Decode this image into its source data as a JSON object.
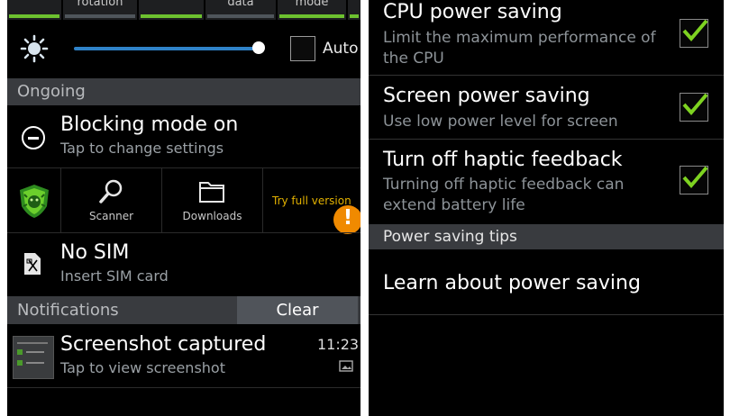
{
  "quick_settings": {
    "toggles": [
      {
        "label": "",
        "on": true
      },
      {
        "label": "rotation",
        "on": false
      },
      {
        "label": "",
        "on": true
      },
      {
        "label": "data",
        "on": false
      },
      {
        "label": "mode",
        "on": true
      }
    ]
  },
  "brightness": {
    "auto_label": "Auto",
    "auto_checked": false,
    "level": 0.97
  },
  "ongoing": {
    "header": "Ongoing",
    "blocking": {
      "title": "Blocking mode on",
      "subtitle": "Tap to change settings"
    },
    "widget": {
      "scanner": "Scanner",
      "downloads": "Downloads",
      "try_full": "Try full version",
      "alert": "!"
    },
    "sim": {
      "title": "No SIM",
      "subtitle": "Insert SIM card"
    }
  },
  "notifications": {
    "header": "Notifications",
    "clear_label": "Clear",
    "items": [
      {
        "title": "Screenshot captured",
        "subtitle": "Tap to view screenshot",
        "time": "11:23"
      }
    ]
  },
  "power_saving": {
    "items": [
      {
        "title": "CPU power saving",
        "subtitle_line1": "Limit the maximum performance of",
        "subtitle_line2": "the CPU",
        "checked": true
      },
      {
        "title": "Screen power saving",
        "subtitle_line1": "Use low power level for screen",
        "subtitle_line2": "",
        "checked": true
      },
      {
        "title": "Turn off haptic feedback",
        "subtitle_line1": "Turning off haptic feedback can",
        "subtitle_line2": "extend battery life",
        "checked": true
      }
    ],
    "tips_header": "Power saving tips",
    "learn_label": "Learn about power saving"
  },
  "colors": {
    "accent_green": "#6dc12f",
    "slider_blue": "#2f82c8",
    "warning_orange": "#f08a00",
    "section_bg": "#393b3f"
  }
}
